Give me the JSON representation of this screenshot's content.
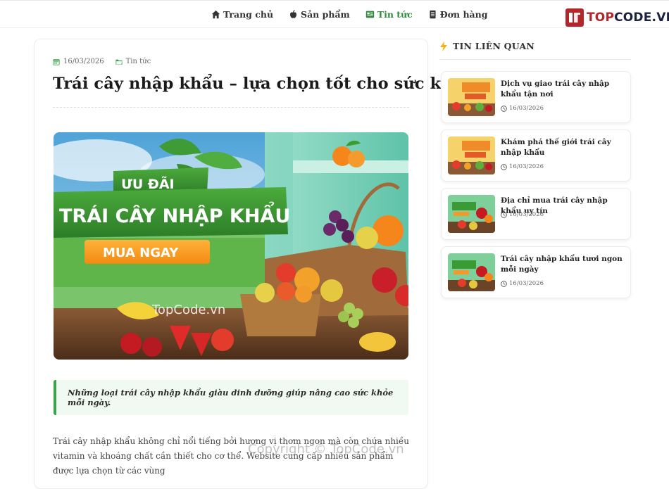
{
  "nav": {
    "items": [
      {
        "label": "Trang chủ",
        "icon": "home-icon"
      },
      {
        "label": "Sản phẩm",
        "icon": "apple-icon"
      },
      {
        "label": "Tin tức",
        "icon": "news-icon",
        "active": true
      },
      {
        "label": "Đơn hàng",
        "icon": "order-icon"
      }
    ],
    "logo_text_top": "TOP",
    "logo_text_rest": "CODE.VN"
  },
  "article": {
    "date": "16/03/2026",
    "category": "Tin tức",
    "title": "Trái cây nhập khẩu – lựa chọn tốt cho sức khỏe",
    "banner": {
      "ribbon_top": "ƯU ĐÃI",
      "ribbon_main": "TRÁI CÂY NHẬP KHẨU",
      "cta": "MUA NGAY",
      "watermark_site": "TopCode.vn"
    },
    "quote": "Những loại trái cây nhập khẩu giàu dinh dưỡng giúp nâng cao sức khỏe mỗi ngày.",
    "body": "Trái cây nhập khẩu không chỉ nổi tiếng bởi hương vị thơm ngon mà còn chứa nhiều vitamin và khoáng chất cần thiết cho cơ thể. Website cung cấp nhiều sản phẩm được lựa chọn từ các vùng",
    "footer_watermark": "Copyright © TopCode.vn"
  },
  "sidebar": {
    "heading": "TIN LIÊN QUAN",
    "related": [
      {
        "title": "Dịch vụ giao trái cây nhập khẩu tận nơi",
        "date": "16/03/2026"
      },
      {
        "title": "Khám phá thế giới trái cây nhập khẩu",
        "date": "16/03/2026"
      },
      {
        "title": "Địa chỉ mua trái cây nhập khẩu uy tín",
        "date": "16/03/2026"
      },
      {
        "title": "Trái cây nhập khẩu tươi ngon mỗi ngày",
        "date": "16/03/2026"
      }
    ]
  },
  "colors": {
    "accent": "#2e8b3a",
    "brand_red": "#b3262a",
    "quote_bg": "#f0faf2"
  }
}
